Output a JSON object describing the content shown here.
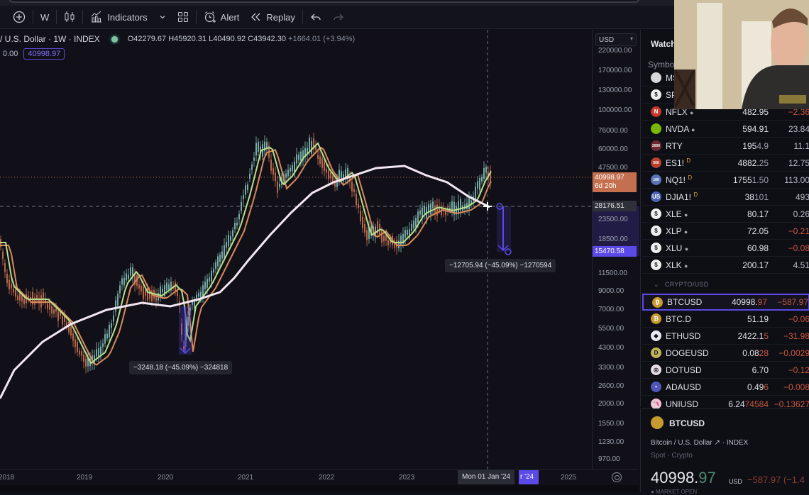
{
  "toolbar": {
    "timeframe": "W",
    "indicators_label": "Indicators",
    "alert_label": "Alert",
    "replay_label": "Replay",
    "icons": [
      "add-symbol-icon",
      "candles-icon",
      "indicators-icon",
      "chevron-down-icon",
      "layouts-icon",
      "alert-icon",
      "replay-icon",
      "undo-icon",
      "redo-icon"
    ]
  },
  "legend": {
    "title": "/ U.S. Dollar · 1W · INDEX",
    "open": "O42279.67",
    "high": "H45920.31",
    "low": "L40490.92",
    "close": "C43942.30",
    "change": "+1664.01 (+3.94%)",
    "line2_value": "0.00",
    "line2_boxed": "40998.97"
  },
  "price_axis": {
    "currency": "USD",
    "ticks": [
      "220000.00",
      "170000.00",
      "130000.00",
      "100000.00",
      "76000.00",
      "60000.00",
      "47500.00",
      "23500.00",
      "18500.00",
      "11500.00",
      "9000.00",
      "7000.00",
      "5500.00",
      "4300.00",
      "3300.00",
      "2600.00",
      "2000.00",
      "1550.00",
      "1230.00",
      "970.00"
    ],
    "current_price": "40998.97",
    "countdown": "6d 20h",
    "crosshair_price": "28176.51",
    "measure_price": "15470.58"
  },
  "time_axis": {
    "years": [
      "2018",
      "2019",
      "2020",
      "2021",
      "2022",
      "2023",
      "2025"
    ],
    "crosshair_date": "Mon 01 Jan '24",
    "measure_date": "r '24"
  },
  "measurements": [
    {
      "label": "−12705.94 (−45.09%) −1270594"
    },
    {
      "label": "−3248.18 (−45.09%) −324818"
    }
  ],
  "colors": {
    "accent": "#5b49e8",
    "up": "#7fb7b0",
    "down": "#c4704f",
    "ema_fast": "#b8e08a",
    "ema_slow": "#d88a5a",
    "ma_long": "#f2e6f2",
    "current_price_tag": "#c4704f"
  },
  "watchlist": {
    "title": "Watch",
    "column_symbol": "Symbo",
    "group_label": "CRYPTO/USD",
    "rows": [
      {
        "sym": "MS",
        "last_a": "",
        "last_b": "",
        "chg": "",
        "icon": "#d8d8d8",
        "glyph": ""
      },
      {
        "sym": "SP",
        "last_a": "",
        "last_b": "",
        "chg": "",
        "icon": "#f0f0f0",
        "glyph": "$"
      },
      {
        "sym": "NFLX",
        "live": "●",
        "last_a": "482.95",
        "last_b": "",
        "chg": "−2.36",
        "neg": true,
        "icon": "#c4372a",
        "glyph": "N"
      },
      {
        "sym": "NVDA",
        "live": "●",
        "last_a": "594.91",
        "last_b": "",
        "chg": "23.84",
        "neg": false,
        "icon": "#76b900",
        "glyph": ""
      },
      {
        "sym": "RTY",
        "last_a": "195",
        "last_b": "4.9",
        "chg": "11.1",
        "neg": false,
        "icon": "#6b2a33",
        "glyph": "2000"
      },
      {
        "sym": "ES1!",
        "sup": "D",
        "last_a": "4882.",
        "last_b": "25",
        "chg": "12.75",
        "neg": false,
        "icon": "#b5412e",
        "glyph": "500"
      },
      {
        "sym": "NQ1!",
        "sup": "D",
        "last_a": "1755",
        "last_b": "1.50",
        "chg": "113.00",
        "neg": false,
        "icon": "#5a74b8",
        "glyph": "100"
      },
      {
        "sym": "DJIA1!",
        "sup": "D",
        "last_a": "38",
        "last_b": "101",
        "chg": "493",
        "neg": false,
        "icon": "#4a63b5",
        "glyph": "US"
      },
      {
        "sym": "XLE",
        "live": "●",
        "last_a": "80.17",
        "last_b": "",
        "chg": "0.26",
        "neg": false,
        "icon": "#f0f0f0",
        "glyph": "$"
      },
      {
        "sym": "XLP",
        "live": "●",
        "last_a": "72.05",
        "last_b": "",
        "chg": "−0.21",
        "neg": true,
        "icon": "#f0f0f0",
        "glyph": "$"
      },
      {
        "sym": "XLU",
        "live": "●",
        "last_a": "60.98",
        "last_b": "",
        "chg": "−0.08",
        "neg": true,
        "icon": "#f0f0f0",
        "glyph": "$"
      },
      {
        "sym": "XLK",
        "live": "●",
        "last_a": "200.17",
        "last_b": "",
        "chg": "4.51",
        "neg": false,
        "icon": "#f0f0f0",
        "glyph": "$"
      }
    ],
    "crypto_rows": [
      {
        "sym": "BTCUSD",
        "last_a": "40998.",
        "last_b": "97",
        "chg": "−587.97",
        "neg": true,
        "icon": "#c69a2e",
        "glyph": "₿",
        "selected": true
      },
      {
        "sym": "BTC.D",
        "last_a": "51.19",
        "last_b": "",
        "chg": "−0.06",
        "neg": true,
        "icon": "#c69a2e",
        "glyph": "₿"
      },
      {
        "sym": "ETHUSD",
        "last_a": "2422.1",
        "last_b": "5",
        "chg": "−31.98",
        "neg": true,
        "icon": "#e8e8f4",
        "glyph": "◆"
      },
      {
        "sym": "DOGEUSD",
        "last_a": "0.08",
        "last_b": "28",
        "chg": "−0.0029",
        "neg": true,
        "icon": "#c2b35a",
        "glyph": "D"
      },
      {
        "sym": "DOTUSD",
        "last_a": "6.70",
        "last_b": "",
        "chg": "−0.12",
        "neg": true,
        "icon": "#e8dde8",
        "glyph": "◎"
      },
      {
        "sym": "ADAUSD",
        "last_a": "0.49",
        "last_b": "6",
        "chg": "−0.008",
        "neg": true,
        "icon": "#5057b8",
        "glyph": "•"
      },
      {
        "sym": "UNIUSD",
        "last_a": "6.24",
        "last_b": "74584",
        "chg": "−0.13627",
        "neg": true,
        "icon": "#f0c6d6",
        "glyph": "🦄"
      }
    ]
  },
  "detail": {
    "symbol": "BTCUSD",
    "description": "Bitcoin / U.S. Dollar ↗ · INDEX",
    "subtitle": "Spot · Crypto",
    "price_main": "40998.",
    "price_dim": "97",
    "currency": "USD",
    "change": "−587.97 (−1.4",
    "market_status": "● MARKET OPEN"
  }
}
